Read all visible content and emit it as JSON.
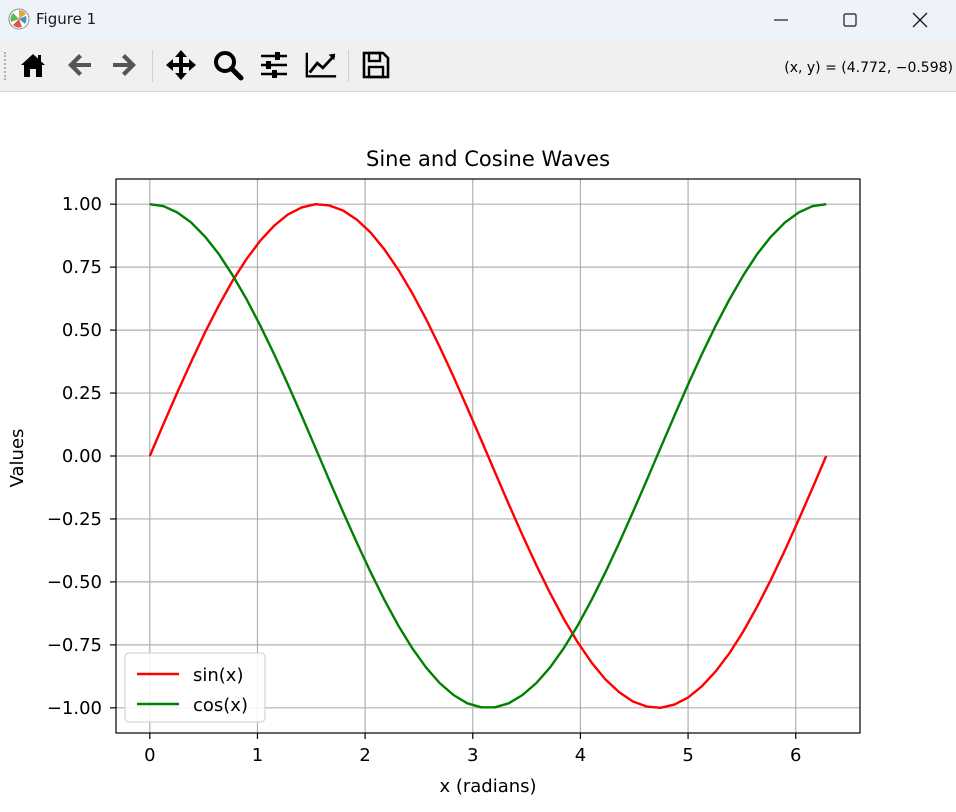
{
  "window": {
    "title": "Figure 1"
  },
  "toolbar": {
    "coords_text": "(x, y) = (4.772, −0.598)",
    "buttons": [
      "home-icon",
      "back-arrow-icon",
      "forward-arrow-icon",
      "pan-move-icon",
      "zoom-magnifier-icon",
      "configure-subplots-icon",
      "edit-axes-icon",
      "save-floppy-icon"
    ]
  },
  "chart_data": {
    "type": "line",
    "title": "Sine and Cosine Waves",
    "xlabel": "x (radians)",
    "ylabel": "Values",
    "xlim": [
      -0.314,
      6.597
    ],
    "ylim": [
      -1.1,
      1.1
    ],
    "xticks": [
      0,
      1,
      2,
      3,
      4,
      5,
      6
    ],
    "xtick_labels": [
      "0",
      "1",
      "2",
      "3",
      "4",
      "5",
      "6"
    ],
    "yticks": [
      -1.0,
      -0.75,
      -0.5,
      -0.25,
      0.0,
      0.25,
      0.5,
      0.75,
      1.0
    ],
    "ytick_labels": [
      "−1.00",
      "−0.75",
      "−0.50",
      "−0.25",
      "0.00",
      "0.25",
      "0.50",
      "0.75",
      "1.00"
    ],
    "grid": true,
    "legend_position": "lower-left",
    "x": [
      0.0,
      0.128,
      0.256,
      0.385,
      0.513,
      0.641,
      0.769,
      0.898,
      1.026,
      1.154,
      1.282,
      1.411,
      1.539,
      1.667,
      1.795,
      1.924,
      2.052,
      2.18,
      2.308,
      2.436,
      2.565,
      2.693,
      2.821,
      2.949,
      3.078,
      3.206,
      3.334,
      3.462,
      3.59,
      3.719,
      3.847,
      3.975,
      4.103,
      4.232,
      4.36,
      4.488,
      4.616,
      4.744,
      4.873,
      5.001,
      5.129,
      5.257,
      5.386,
      5.514,
      5.642,
      5.77,
      5.899,
      6.027,
      6.155,
      6.283
    ],
    "series": [
      {
        "name": "sin(x)",
        "color": "#ff0000",
        "values": [
          0.0,
          0.128,
          0.253,
          0.375,
          0.491,
          0.598,
          0.696,
          0.782,
          0.855,
          0.914,
          0.959,
          0.987,
          1.0,
          0.995,
          0.975,
          0.938,
          0.887,
          0.82,
          0.74,
          0.648,
          0.545,
          0.433,
          0.315,
          0.191,
          0.064,
          -0.064,
          -0.191,
          -0.315,
          -0.433,
          -0.545,
          -0.648,
          -0.74,
          -0.82,
          -0.887,
          -0.938,
          -0.975,
          -0.995,
          -1.0,
          -0.987,
          -0.959,
          -0.914,
          -0.855,
          -0.782,
          -0.696,
          -0.598,
          -0.491,
          -0.375,
          -0.253,
          -0.128,
          0.0
        ]
      },
      {
        "name": "cos(x)",
        "color": "#008000",
        "values": [
          1.0,
          0.992,
          0.967,
          0.927,
          0.871,
          0.802,
          0.718,
          0.623,
          0.518,
          0.405,
          0.285,
          0.16,
          0.032,
          -0.096,
          -0.222,
          -0.345,
          -0.462,
          -0.572,
          -0.673,
          -0.762,
          -0.839,
          -0.902,
          -0.949,
          -0.982,
          -0.998,
          -0.998,
          -0.982,
          -0.949,
          -0.902,
          -0.839,
          -0.762,
          -0.673,
          -0.572,
          -0.462,
          -0.345,
          -0.222,
          -0.096,
          0.032,
          0.16,
          0.285,
          0.405,
          0.518,
          0.623,
          0.718,
          0.802,
          0.871,
          0.927,
          0.967,
          0.992,
          1.0
        ]
      }
    ]
  }
}
